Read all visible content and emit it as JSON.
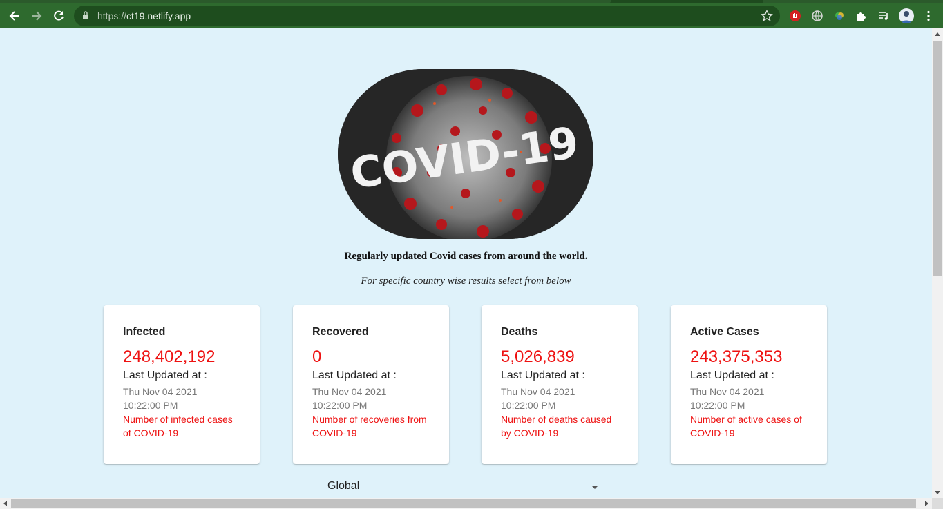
{
  "browser": {
    "url_scheme": "https://",
    "url_host": "ct19.netlify.app"
  },
  "hero": {
    "image_text": "COVID-19"
  },
  "header": {
    "tagline": "Regularly updated Covid cases from around the world.",
    "subline": "For specific country wise results select from below"
  },
  "cards": [
    {
      "title": "Infected",
      "value": "248,402,192",
      "updated_label": "Last Updated at :",
      "date": "Thu Nov 04 2021",
      "time": "10:22:00 PM",
      "description": "Number of infected cases of COVID-19"
    },
    {
      "title": "Recovered",
      "value": "0",
      "updated_label": "Last Updated at :",
      "date": "Thu Nov 04 2021",
      "time": "10:22:00 PM",
      "description": "Number of recoveries from COVID-19"
    },
    {
      "title": "Deaths",
      "value": "5,026,839",
      "updated_label": "Last Updated at :",
      "date": "Thu Nov 04 2021",
      "time": "10:22:00 PM",
      "description": "Number of deaths caused by COVID-19"
    },
    {
      "title": "Active Cases",
      "value": "243,375,353",
      "updated_label": "Last Updated at :",
      "date": "Thu Nov 04 2021",
      "time": "10:22:00 PM",
      "description": "Number of active cases of COVID-19"
    }
  ],
  "country_select": {
    "selected": "Global"
  },
  "colors": {
    "page_background": "#dff2fa",
    "accent_red": "#ee1111",
    "browser_green": "#2e6a2e"
  }
}
